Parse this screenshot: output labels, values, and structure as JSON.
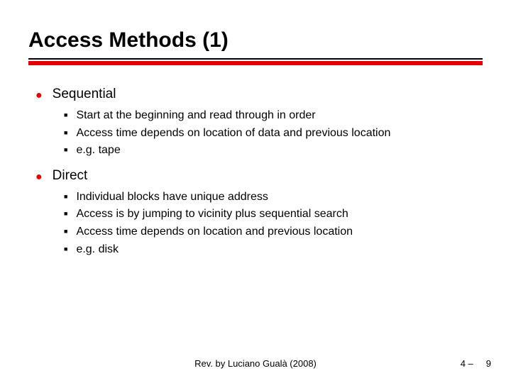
{
  "title": "Access Methods (1)",
  "bullets": {
    "b1": {
      "label": "Sequential",
      "s1": "Start at the beginning and read through in order",
      "s2": "Access time depends on location of data and previous location",
      "s3": "e.g. tape"
    },
    "b2": {
      "label": "Direct",
      "s1": "Individual blocks have unique address",
      "s2": "Access is by jumping to vicinity plus sequential search",
      "s3": "Access time depends on location and previous location",
      "s4": "e.g. disk"
    }
  },
  "footer": {
    "center": "Rev. by Luciano Gualà (2008)",
    "chapter": "4 –",
    "page": "9"
  }
}
